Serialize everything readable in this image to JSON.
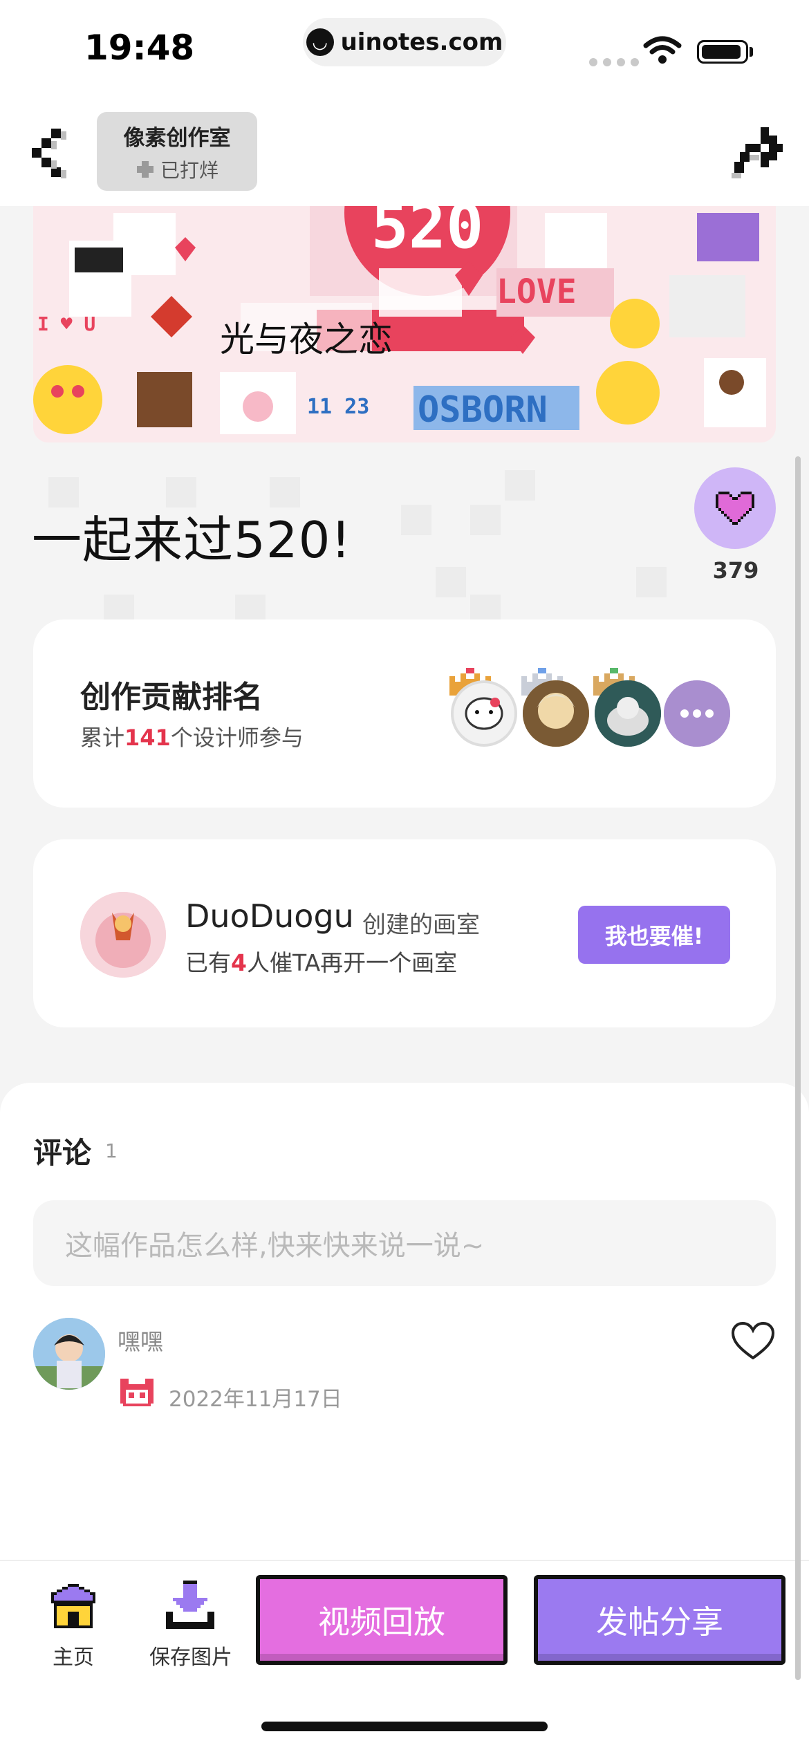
{
  "status_bar": {
    "time": "19:48",
    "url": "uinotes.com"
  },
  "nav": {
    "studio_title": "像素创作室",
    "studio_status": "已打烊"
  },
  "banner": {
    "texts": [
      "520",
      "LOVE",
      "OSBORN",
      "11 23",
      "光与夜之恋",
      "I ♥ U"
    ]
  },
  "artwork": {
    "title": "一起来过520!",
    "like_count": "379"
  },
  "ranking": {
    "title": "创作贡献排名",
    "sub_prefix": "累计",
    "designer_count": "141",
    "sub_suffix": "个设计师参与"
  },
  "creator": {
    "name": "DuoDuogu",
    "suffix": "创建的画室",
    "info_prefix": "已有",
    "urge_count": "4",
    "info_suffix": "人催TA再开一个画室",
    "urge_button": "我也要催!"
  },
  "comments": {
    "title": "评论",
    "count": "1",
    "placeholder": "这幅作品怎么样,快来快来说一说~",
    "items": [
      {
        "user": "嘿嘿",
        "date": "2022年11月17日"
      }
    ]
  },
  "bottom": {
    "home_label": "主页",
    "save_label": "保存图片",
    "replay_button": "视频回放",
    "post_button": "发帖分享"
  },
  "colors": {
    "accent_purple": "#9672ee",
    "pink_button": "#e46ee0",
    "highlight_red": "#e4344c",
    "like_bg": "#cfb6f7"
  }
}
